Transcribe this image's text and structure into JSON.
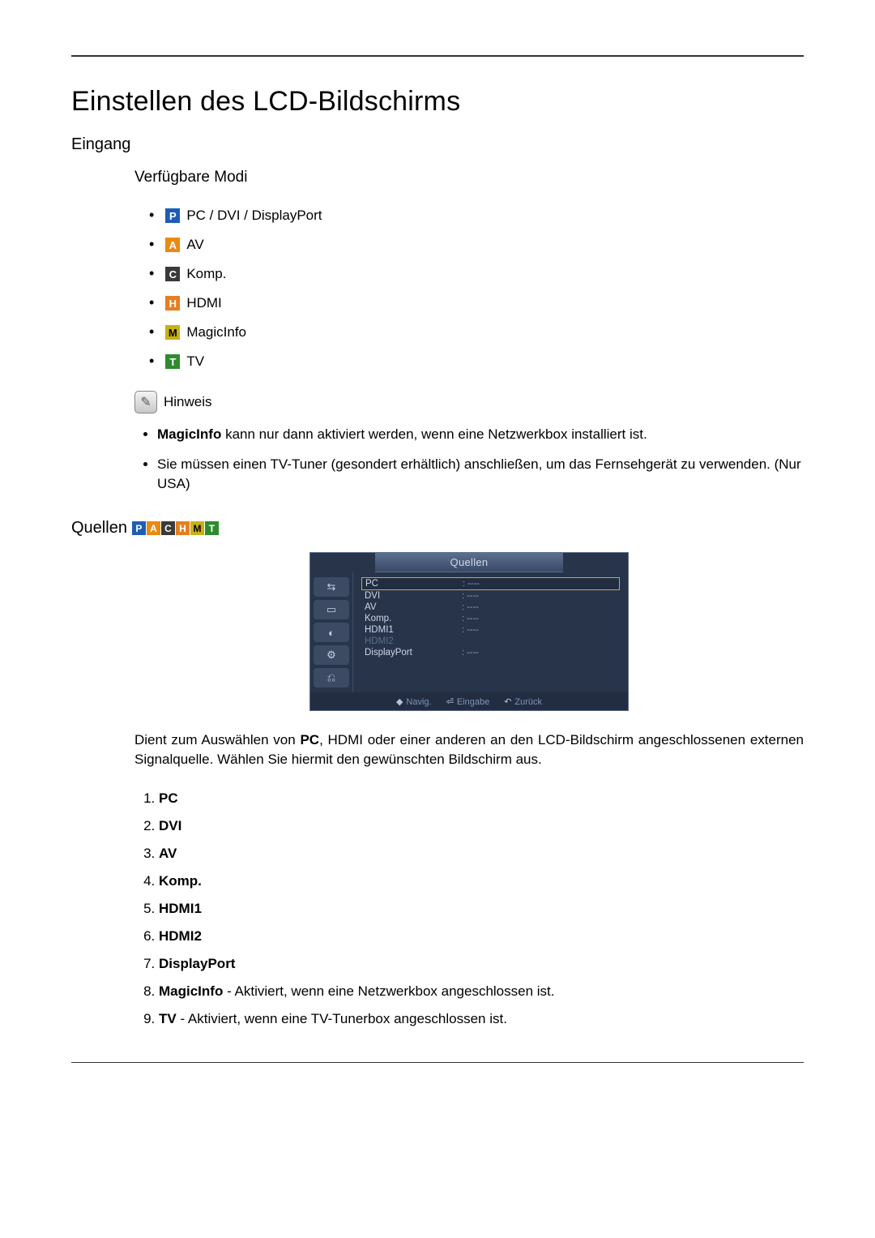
{
  "title": "Einstellen des LCD-Bildschirms",
  "section_input": "Eingang",
  "subsection_modes": "Verfügbare Modi",
  "modes": [
    {
      "letter": "P",
      "cls": "mi-P",
      "label": "PC / DVI / DisplayPort"
    },
    {
      "letter": "A",
      "cls": "mi-A",
      "label": "AV"
    },
    {
      "letter": "C",
      "cls": "mi-C",
      "label": "Komp."
    },
    {
      "letter": "H",
      "cls": "mi-H",
      "label": "HDMI"
    },
    {
      "letter": "M",
      "cls": "mi-M",
      "label": "MagicInfo"
    },
    {
      "letter": "T",
      "cls": "mi-T",
      "label": "TV"
    }
  ],
  "note_label": "Hinweis",
  "note_bullets": {
    "b1_strong": "MagicInfo",
    "b1_rest": " kann nur dann aktiviert werden, wenn eine Netzwerkbox installiert ist.",
    "b2": "Sie müssen einen TV-Tuner (gesondert erhältlich) anschließen, um das Fernsehgerät zu verwenden. (Nur USA)"
  },
  "sources_heading": "Quellen",
  "osd": {
    "title": "Quellen",
    "rows": [
      {
        "label": "PC",
        "value": ": ----",
        "sel": true
      },
      {
        "label": "DVI",
        "value": ": ----"
      },
      {
        "label": "AV",
        "value": ": ----"
      },
      {
        "label": "Komp.",
        "value": ": ----"
      },
      {
        "label": "HDMI1",
        "value": ": ----"
      },
      {
        "label": "HDMI2",
        "value": "",
        "dim": true
      },
      {
        "label": "DisplayPort",
        "value": ": ----"
      }
    ],
    "foot": {
      "navig": "Navig.",
      "eingabe": "Eingabe",
      "zuruck": "Zurück"
    }
  },
  "desc_pre": "Dient zum Auswählen von ",
  "desc_strong": "PC",
  "desc_post": ", HDMI oder einer anderen an den LCD-Bildschirm angeschlossenen externen Signalquelle. Wählen Sie hiermit den gewünschten Bildschirm aus.",
  "numbered": {
    "i1": "PC",
    "i2": "DVI",
    "i3": "AV",
    "i4": "Komp.",
    "i5": "HDMI1",
    "i6": "HDMI2",
    "i7": "DisplayPort",
    "i8_strong": "MagicInfo",
    "i8_rest": " - Aktiviert, wenn eine Netzwerkbox angeschlossen ist.",
    "i9_strong": "TV",
    "i9_rest": " - Aktiviert, wenn eine TV-Tunerbox angeschlossen ist."
  }
}
